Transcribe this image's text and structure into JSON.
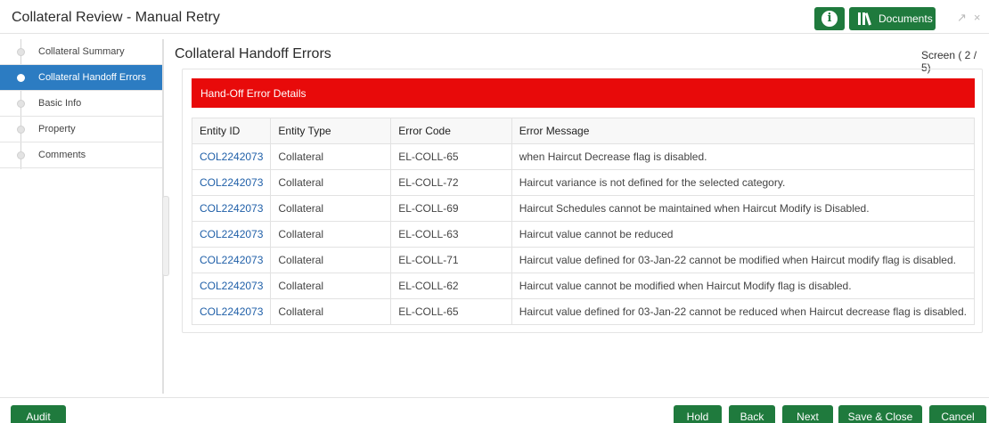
{
  "window": {
    "title": "Collateral Review - Manual Retry",
    "documents_label": "Documents",
    "info_glyph": "i",
    "icons": [
      "info-icon",
      "library-icon",
      "expand-icon",
      "close-icon"
    ]
  },
  "sidebar": {
    "items": [
      {
        "label": "Collateral Summary",
        "active": false
      },
      {
        "label": "Collateral Handoff Errors",
        "active": true
      },
      {
        "label": "Basic Info",
        "active": false
      },
      {
        "label": "Property",
        "active": false
      },
      {
        "label": "Comments",
        "active": false
      }
    ]
  },
  "main": {
    "title": "Collateral Handoff Errors",
    "screen_indicator": "Screen ( 2 / 5)",
    "error_banner": "Hand-Off Error Details",
    "table": {
      "headers": [
        "Entity ID",
        "Entity Type",
        "Error Code",
        "Error Message"
      ],
      "rows": [
        [
          "COL2242073",
          "Collateral",
          "EL-COLL-65",
          "when Haircut Decrease flag is disabled."
        ],
        [
          "COL2242073",
          "Collateral",
          "EL-COLL-72",
          "Haircut variance is not defined for the selected category."
        ],
        [
          "COL2242073",
          "Collateral",
          "EL-COLL-69",
          "Haircut Schedules cannot be maintained when Haircut Modify is Disabled."
        ],
        [
          "COL2242073",
          "Collateral",
          "EL-COLL-63",
          "Haircut value cannot be reduced"
        ],
        [
          "COL2242073",
          "Collateral",
          "EL-COLL-71",
          "Haircut value defined for 03-Jan-22 cannot be modified when Haircut modify flag is disabled."
        ],
        [
          "COL2242073",
          "Collateral",
          "EL-COLL-62",
          "Haircut value cannot be modified when Haircut Modify flag is disabled."
        ],
        [
          "COL2242073",
          "Collateral",
          "EL-COLL-65",
          "Haircut value defined for 03-Jan-22 cannot be reduced when Haircut decrease flag is disabled."
        ]
      ]
    }
  },
  "footer": {
    "audit": "Audit",
    "hold": "Hold",
    "back": "Back",
    "next": "Next",
    "save_close": "Save & Close",
    "cancel": "Cancel"
  },
  "colors": {
    "primary_green": "#1f7a3d",
    "active_blue": "#2c7cc2",
    "error_red": "#e80a0a",
    "link_blue": "#1f5fa8"
  }
}
